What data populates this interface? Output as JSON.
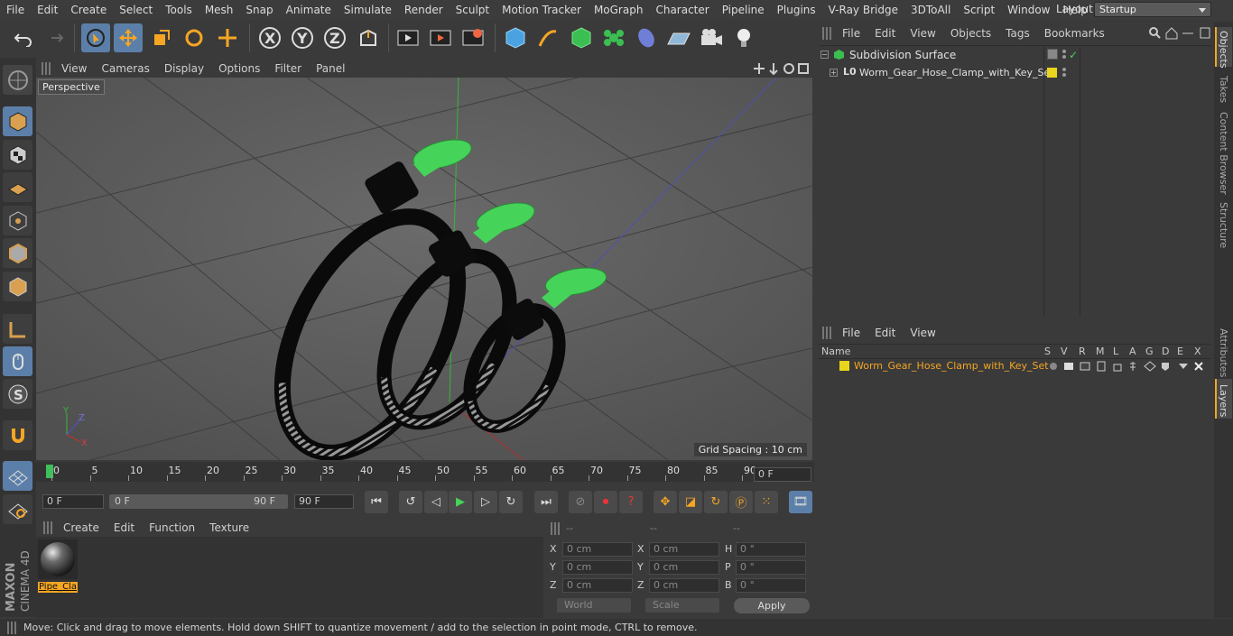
{
  "menu": [
    "File",
    "Edit",
    "Create",
    "Select",
    "Tools",
    "Mesh",
    "Snap",
    "Animate",
    "Simulate",
    "Render",
    "Sculpt",
    "Motion Tracker",
    "MoGraph",
    "Character",
    "Pipeline",
    "Plugins",
    "V-Ray Bridge",
    "3DToAll",
    "Script",
    "Window",
    "Help"
  ],
  "layout": {
    "label": "Layout:",
    "value": "Startup"
  },
  "viewport": {
    "menu": [
      "View",
      "Cameras",
      "Display",
      "Options",
      "Filter",
      "Panel"
    ],
    "label": "Perspective",
    "grid_spacing": "Grid Spacing : 10 cm"
  },
  "timeline": {
    "ticks": [
      "0",
      "5",
      "10",
      "15",
      "20",
      "25",
      "30",
      "35",
      "40",
      "45",
      "50",
      "55",
      "60",
      "65",
      "70",
      "75",
      "80",
      "85",
      "90"
    ],
    "current_frame": "0 F",
    "start": "0 F",
    "range_start": "0 F",
    "range_end": "90 F",
    "end": "90 F"
  },
  "materials": {
    "menu": [
      "Create",
      "Edit",
      "Function",
      "Texture"
    ],
    "items": [
      {
        "name": "Pipe_Cla"
      }
    ]
  },
  "coords": {
    "headers": [
      "--",
      "--",
      "--"
    ],
    "rows": [
      {
        "a": "X",
        "av": "0 cm",
        "b": "X",
        "bv": "0 cm",
        "c": "H",
        "cv": "0 °"
      },
      {
        "a": "Y",
        "av": "0 cm",
        "b": "Y",
        "bv": "0 cm",
        "c": "P",
        "cv": "0 °"
      },
      {
        "a": "Z",
        "av": "0 cm",
        "b": "Z",
        "bv": "0 cm",
        "c": "B",
        "cv": "0 °"
      }
    ],
    "world": "World",
    "scale": "Scale",
    "apply": "Apply"
  },
  "objects": {
    "menu": [
      "File",
      "Edit",
      "View",
      "Objects",
      "Tags",
      "Bookmarks"
    ],
    "items": [
      {
        "name": "Subdivision Surface"
      },
      {
        "name": "Worm_Gear_Hose_Clamp_with_Key_Set"
      }
    ]
  },
  "layers": {
    "menu": [
      "File",
      "Edit",
      "View"
    ],
    "columns": [
      "Name",
      "S",
      "V",
      "R",
      "M",
      "L",
      "A",
      "G",
      "D",
      "E",
      "X"
    ],
    "items": [
      {
        "name": "Worm_Gear_Hose_Clamp_with_Key_Set",
        "color": "#e8d51c"
      }
    ]
  },
  "side_tabs": [
    "Objects",
    "Takes",
    "Content Browser",
    "Structure",
    "Attributes",
    "Layers"
  ],
  "brand": "MAXON CINEMA 4D",
  "status": "Move: Click and drag to move elements. Hold down SHIFT to quantize movement / add to the selection in point mode, CTRL to remove.",
  "colors": {
    "accent": "#5b7fa8",
    "highlight": "#f5a623",
    "clamp_key": "#46d35a"
  }
}
